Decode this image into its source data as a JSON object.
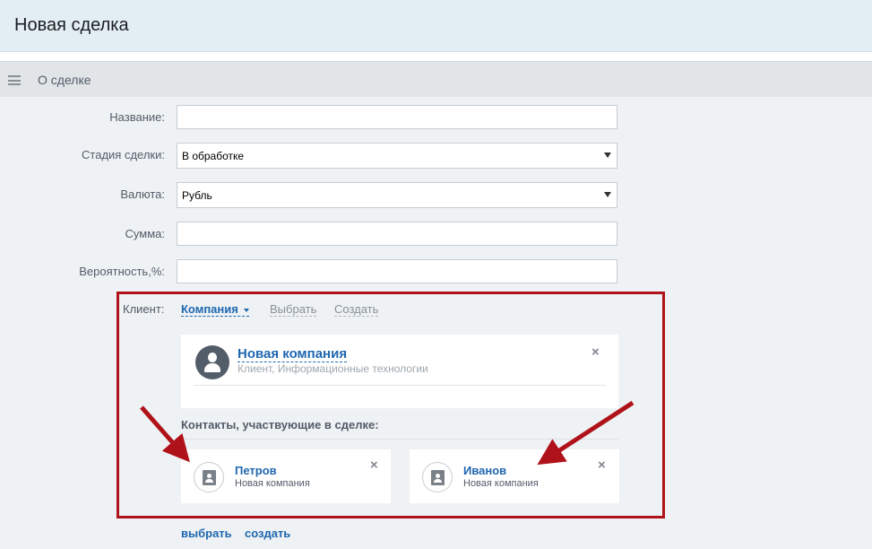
{
  "header": {
    "title": "Новая сделка"
  },
  "section": {
    "title": "О сделке"
  },
  "form": {
    "name_label": "Название:",
    "name_value": "",
    "stage_label": "Стадия сделки:",
    "stage_value": "В обработке",
    "currency_label": "Валюта:",
    "currency_value": "Рубль",
    "sum_label": "Сумма:",
    "sum_value": "",
    "probability_label": "Вероятность,%:",
    "probability_value": ""
  },
  "client": {
    "label": "Клиент:",
    "mode_company": "Компания",
    "mode_pick": "Выбрать",
    "mode_create": "Создать",
    "company": {
      "name": "Новая компания",
      "subtitle": "Клиент, Информационные технологии"
    },
    "contacts_title": "Контакты, участвующие в сделке:",
    "contacts": [
      {
        "name": "Петров",
        "company": "Новая компания"
      },
      {
        "name": "Иванов",
        "company": "Новая компания"
      }
    ]
  },
  "bottom_links": {
    "pick": "выбрать",
    "create": "создать"
  },
  "icons": {
    "close": "×",
    "menu": "menu-icon",
    "company_avatar": "user-silhouette-icon",
    "contact_avatar": "address-book-icon"
  },
  "colors": {
    "accent": "#2067b0",
    "highlight_frame": "#b0121a",
    "header_bg": "#e2eef4"
  }
}
